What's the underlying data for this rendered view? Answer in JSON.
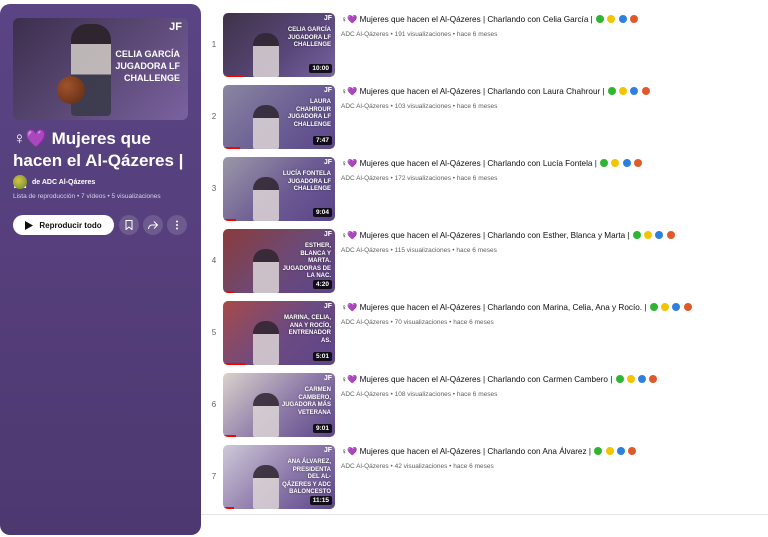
{
  "playlist": {
    "thumb_overlay": "CELIA GARCÍA JUGADORA LF CHALLENGE",
    "thumb_logo": "JF",
    "title": "♀💜 Mujeres que hacen el Al-Qázeres | ...",
    "owner": "de ADC Al-Qázeres",
    "meta": "Lista de reproducción • 7 vídeos • 5 visualizaciones",
    "play_all_label": "Reproducir todo"
  },
  "colors": {
    "panel": "#563f7c",
    "progress": "#ff0000",
    "green_heart": "#2fb52f",
    "yellow_heart": "#f5c400",
    "blue_heart": "#2f7fe0",
    "ball": "#e0592a"
  },
  "videos": [
    {
      "index": "1",
      "title": "♀💜 Mujeres que hacen el Al-Qázeres | Charlando con Celia García |",
      "channel": "ADC Al-Qázeres",
      "views": "191 visualizaciones",
      "age": "hace 6 meses",
      "duration": "10:00",
      "overlay": "CELIA GARCÍA JUGADORA LF CHALLENGE"
    },
    {
      "index": "2",
      "title": "♀💜 Mujeres que hacen el Al-Qázeres | Charlando con Laura Chahrour |",
      "channel": "ADC Al-Qázeres",
      "views": "103 visualizaciones",
      "age": "hace 6 meses",
      "duration": "7:47",
      "overlay": "LAURA CHAHROUR JUGADORA LF CHALLENGE"
    },
    {
      "index": "3",
      "title": "♀💜 Mujeres que hacen el Al-Qázeres | Charlando con Lucía Fontela |",
      "channel": "ADC Al-Qázeres",
      "views": "172 visualizaciones",
      "age": "hace 6 meses",
      "duration": "9:04",
      "overlay": "LUCÍA FONTELA JUGADORA LF CHALLENGE"
    },
    {
      "index": "4",
      "title": "♀💜 Mujeres que hacen el Al-Qázeres | Charlando con Esther, Blanca y Marta |",
      "channel": "ADC Al-Qázeres",
      "views": "115 visualizaciones",
      "age": "hace 6 meses",
      "duration": "4:20",
      "overlay": "ESTHER, BLANCA Y MARTA. JUGADORAS DE LA NAC."
    },
    {
      "index": "5",
      "title": "♀💜 Mujeres que hacen el Al-Qázeres | Charlando con Marina, Celia, Ana y Rocío. |",
      "channel": "ADC Al-Qázeres",
      "views": "70 visualizaciones",
      "age": "hace 6 meses",
      "duration": "5:01",
      "overlay": "MARINA, CELIA, ANA Y ROCÍO, ENTRENADOR AS."
    },
    {
      "index": "6",
      "title": "♀💜 Mujeres que hacen el Al-Qázeres | Charlando con Carmen Cambero |",
      "channel": "ADC Al-Qázeres",
      "views": "108 visualizaciones",
      "age": "hace 6 meses",
      "duration": "9:01",
      "overlay": "CARMEN CAMBERO, JUGADORA MÁS VETERANA"
    },
    {
      "index": "7",
      "title": "♀💜 Mujeres que hacen el Al-Qázeres | Charlando con Ana Álvarez |",
      "channel": "ADC Al-Qázeres",
      "views": "42 visualizaciones",
      "age": "hace 6 meses",
      "duration": "11:15",
      "overlay": "ANA ÁLVAREZ, PRESIDENTA DEL AL-QÁZERES Y ADC BALONCESTO"
    }
  ]
}
